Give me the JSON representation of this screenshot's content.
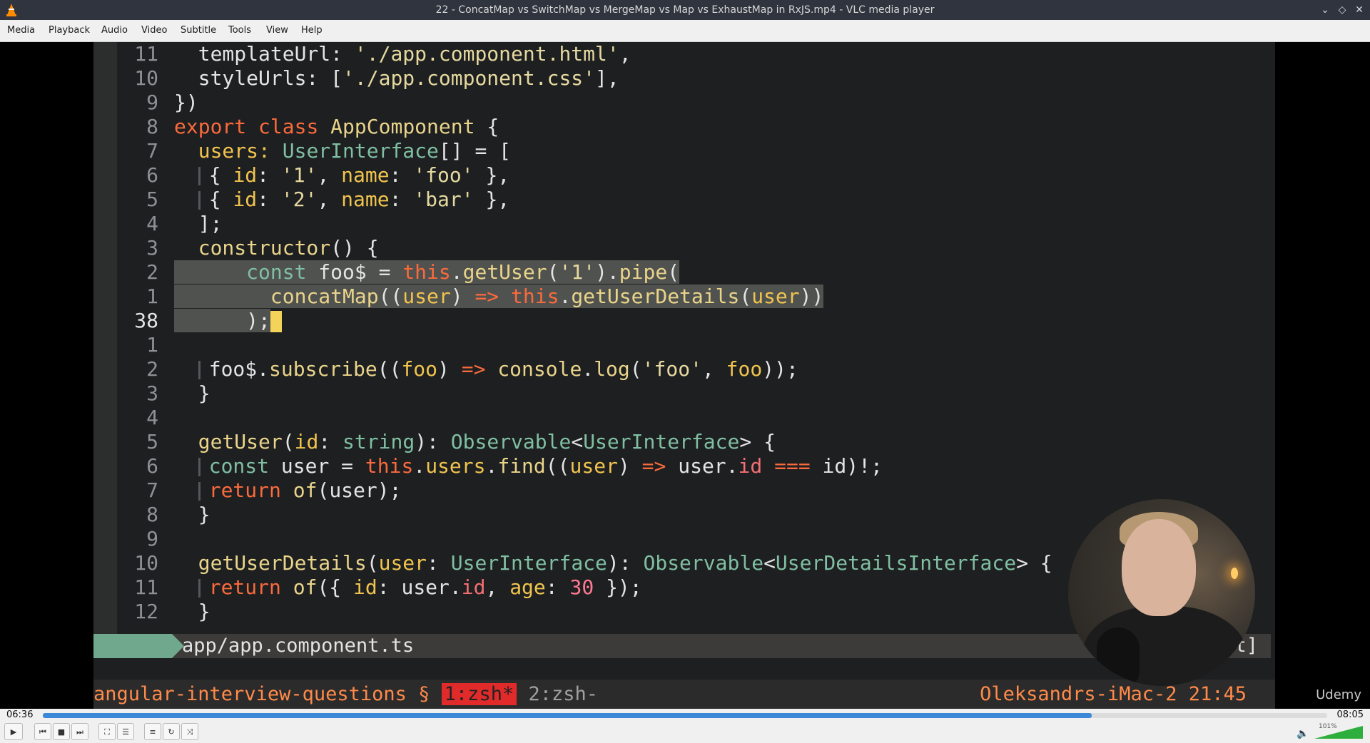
{
  "window": {
    "title": "22 - ConcatMap vs SwitchMap vs MergeMap vs Map vs ExhaustMap in RxJS.mp4 - VLC media player"
  },
  "menu": [
    "Media",
    "Playback",
    "Audio",
    "Video",
    "Subtitle",
    "Tools",
    "View",
    "Help"
  ],
  "editor": {
    "line_numbers": [
      "11",
      "10",
      "9",
      "8",
      "7",
      "6",
      "5",
      "4",
      "3",
      "2",
      "1",
      "38",
      "1",
      "2",
      "3",
      "4",
      "5",
      "6",
      "7",
      "8",
      "9",
      "10",
      "11",
      "12"
    ],
    "lines": {
      "l0": [
        "templateUrl: ",
        "'./app.component.html'",
        ","
      ],
      "l1": [
        "styleUrls: [",
        "'./app.component.css'",
        "],"
      ],
      "l2": [
        "})"
      ],
      "l3": [
        "export",
        " ",
        "class",
        " ",
        "AppComponent",
        " {"
      ],
      "l4": [
        "users: ",
        "UserInterface",
        "[] = ["
      ],
      "l5": [
        "{ ",
        "id",
        ": ",
        "'1'",
        ", ",
        "name",
        ": ",
        "'foo'",
        " },"
      ],
      "l6": [
        "{ ",
        "id",
        ": ",
        "'2'",
        ", ",
        "name",
        ": ",
        "'bar'",
        " },"
      ],
      "l7": [
        "];"
      ],
      "l8": [
        "constructor",
        "() {"
      ],
      "l9": [
        "const",
        " foo$ = ",
        "this",
        ".",
        "getUser",
        "(",
        "'1'",
        ").",
        "pipe",
        "("
      ],
      "l10": [
        "concatMap",
        "((",
        "user",
        ") ",
        "=>",
        " ",
        "this",
        ".",
        "getUserDetails",
        "(",
        "user",
        "))"
      ],
      "l11": [
        ");"
      ],
      "l12": [
        ""
      ],
      "l13": [
        "foo$.",
        "subscribe",
        "((",
        "foo",
        ") ",
        "=>",
        " ",
        "console",
        ".",
        "log",
        "(",
        "'foo'",
        ", ",
        "foo",
        "));"
      ],
      "l14": [
        "}"
      ],
      "l15": [
        ""
      ],
      "l16": [
        "getUser",
        "(",
        "id",
        ": ",
        "string",
        "): ",
        "Observable",
        "<",
        "UserInterface",
        "> {"
      ],
      "l17": [
        "const",
        " ",
        "user",
        " = ",
        "this",
        ".",
        "users",
        ".",
        "find",
        "((",
        "user",
        ") ",
        "=>",
        " ",
        "user",
        ".",
        "id",
        " ",
        "===",
        " ",
        "id",
        ")!;"
      ],
      "l18": [
        "return",
        " ",
        "of",
        "(",
        "user",
        ");"
      ],
      "l19": [
        "}"
      ],
      "l20": [
        ""
      ],
      "l21": [
        "getUserDetails",
        "(",
        "user",
        ": ",
        "UserInterface",
        "): ",
        "Observable",
        "<",
        "UserDetailsInterface",
        "> {"
      ],
      "l22": [
        "return",
        " ",
        "of",
        "({ ",
        "id",
        ": ",
        "user",
        ".",
        "id",
        ", ",
        "age",
        ": ",
        "30",
        " });"
      ],
      "l23": [
        "}"
      ]
    },
    "status_file": "app/app.component.ts",
    "status_right": "t]"
  },
  "tmux": {
    "session": "angular-interview-questions § ",
    "active_window": "1:zsh*",
    "inactive_window": " 2:zsh-",
    "host_time": "Oleksandrs-iMac-2 21:45"
  },
  "watermark": "Udemy",
  "playback": {
    "current_time": "06:36",
    "total_time": "08:05",
    "progress_fraction": 0.8165,
    "volume_label": "101%"
  },
  "colors": {
    "accent": "#3b88d8",
    "keyword": "#fa6a3c",
    "type": "#80bfa2",
    "string": "#e6d9a0",
    "tmux_active": "#e12b2b"
  }
}
